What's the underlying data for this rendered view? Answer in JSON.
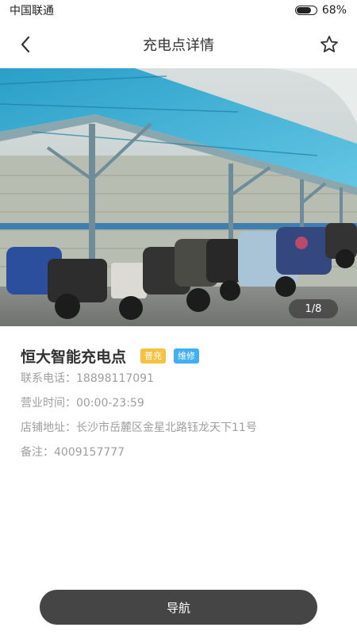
{
  "status_bar": {
    "carrier": "中国联通",
    "battery_percent": "68%",
    "battery_level": 0.68
  },
  "header": {
    "title": "充电点详情",
    "back_icon": "back-arrow-icon",
    "favorite_icon": "star-icon"
  },
  "photo": {
    "counter": "1/8"
  },
  "station": {
    "name": "恒大智能充电点",
    "tags": [
      {
        "label": "普充",
        "color": "#f7c142"
      },
      {
        "label": "维修",
        "color": "#40b0f0"
      }
    ],
    "phone": "联系电话：18898117091",
    "hours": "营业时间：00:00-23:59",
    "address": "店铺地址：长沙市岳麓区金星北路钰龙天下11号",
    "note": "备注：4009157777"
  },
  "footer": {
    "navigate_label": "导航"
  },
  "colors": {
    "accent_dark": "#454545",
    "tag_yellow": "#f7c142",
    "tag_blue": "#40b0f0"
  }
}
